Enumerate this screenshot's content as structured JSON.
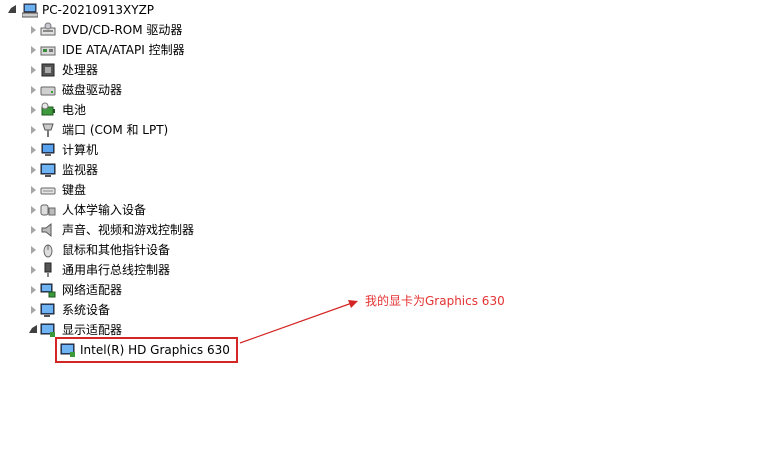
{
  "root": {
    "label": "PC-20210913XYZP",
    "expanded": true
  },
  "categories": [
    {
      "label": "DVD/CD-ROM 驱动器",
      "icon": "dvd-drive-icon"
    },
    {
      "label": "IDE ATA/ATAPI 控制器",
      "icon": "ide-controller-icon"
    },
    {
      "label": "处理器",
      "icon": "processor-icon"
    },
    {
      "label": "磁盘驱动器",
      "icon": "disk-drive-icon"
    },
    {
      "label": "电池",
      "icon": "battery-icon"
    },
    {
      "label": "端口 (COM 和 LPT)",
      "icon": "port-icon"
    },
    {
      "label": "计算机",
      "icon": "computer-icon"
    },
    {
      "label": "监视器",
      "icon": "monitor-icon"
    },
    {
      "label": "键盘",
      "icon": "keyboard-icon"
    },
    {
      "label": "人体学输入设备",
      "icon": "hid-icon"
    },
    {
      "label": "声音、视频和游戏控制器",
      "icon": "speaker-icon"
    },
    {
      "label": "鼠标和其他指针设备",
      "icon": "mouse-icon"
    },
    {
      "label": "通用串行总线控制器",
      "icon": "usb-icon"
    },
    {
      "label": "网络适配器",
      "icon": "network-adapter-icon"
    },
    {
      "label": "系统设备",
      "icon": "system-device-icon"
    },
    {
      "label": "显示适配器",
      "icon": "display-adapter-icon",
      "expanded": true
    }
  ],
  "display_adapter_child": {
    "label": "Intel(R) HD Graphics 630",
    "icon": "display-adapter-icon"
  },
  "annotation": {
    "text": "我的显卡为Graphics 630",
    "color": "#e53333"
  }
}
